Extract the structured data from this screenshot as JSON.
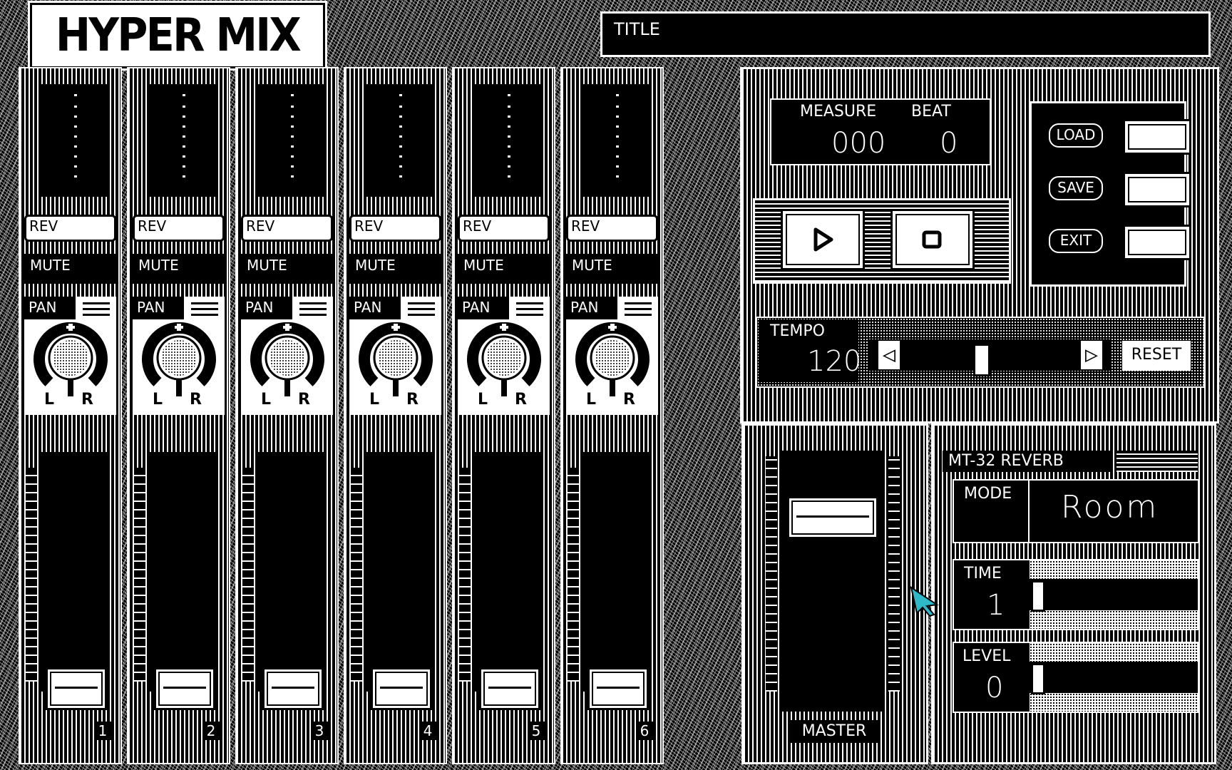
{
  "app": {
    "logo": "HYPER MIX",
    "title_label": "TITLE"
  },
  "channels": [
    {
      "rev": "REV",
      "mute": "MUTE",
      "pan": "PAN",
      "left": "L",
      "right": "R",
      "number": "1"
    },
    {
      "rev": "REV",
      "mute": "MUTE",
      "pan": "PAN",
      "left": "L",
      "right": "R",
      "number": "2"
    },
    {
      "rev": "REV",
      "mute": "MUTE",
      "pan": "PAN",
      "left": "L",
      "right": "R",
      "number": "3"
    },
    {
      "rev": "REV",
      "mute": "MUTE",
      "pan": "PAN",
      "left": "L",
      "right": "R",
      "number": "4"
    },
    {
      "rev": "REV",
      "mute": "MUTE",
      "pan": "PAN",
      "left": "L",
      "right": "R",
      "number": "5"
    },
    {
      "rev": "REV",
      "mute": "MUTE",
      "pan": "PAN",
      "left": "L",
      "right": "R",
      "number": "6"
    }
  ],
  "counter": {
    "measure_label": "MEASURE",
    "beat_label": "BEAT",
    "measure": "000",
    "beat": "0"
  },
  "file": {
    "load": "LOAD",
    "save": "SAVE",
    "exit": "EXIT"
  },
  "tempo": {
    "label": "TEMPO",
    "value": "120",
    "reset": "RESET",
    "slider_position": 0.45
  },
  "master": {
    "label": "MASTER",
    "level": 0.85
  },
  "reverb": {
    "title": "MT-32  REVERB",
    "mode_label": "MODE",
    "mode": "Room",
    "time_label": "TIME",
    "time": "1",
    "level_label": "LEVEL",
    "level": "0"
  },
  "icons": {
    "play": "play-icon",
    "stop": "stop-icon",
    "left": "arrow-left-icon",
    "right": "arrow-right-icon"
  },
  "colors": {
    "cursor": "#2fb8c8"
  }
}
